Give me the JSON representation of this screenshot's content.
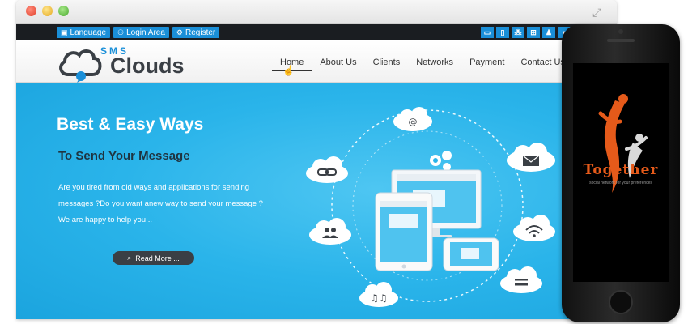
{
  "topbar": {
    "links": [
      {
        "label": "Language",
        "icon": "language-icon"
      },
      {
        "label": "Login Area",
        "icon": "user-icon"
      },
      {
        "label": "Register",
        "icon": "register-icon"
      }
    ],
    "social_icons": [
      "desktop-icon",
      "tablet-icon",
      "blackberry-icon",
      "windows-icon",
      "android-icon",
      "apple-icon",
      "rss-icon",
      "facebook-icon",
      "twitter-icon"
    ]
  },
  "logo": {
    "small": "SMS",
    "main": "Clouds"
  },
  "nav": {
    "items": [
      "Home",
      "About Us",
      "Clients",
      "Networks",
      "Payment",
      "Contact Us"
    ],
    "active": "Home"
  },
  "hero": {
    "title": "Best & Easy Ways",
    "subtitle": "To Send Your Message",
    "text_lines": [
      "Are you tired from old ways and applications for sending",
      "messages ?Do you want anew way to send your message ?",
      "We are happy to help you .."
    ],
    "button": "Read More ..."
  },
  "phone": {
    "app_name": "Together",
    "tagline": "social network for your preferences"
  },
  "colors": {
    "accent": "#1a8fd8",
    "hero_bg": "#2ab4ea",
    "dark": "#3a3f45",
    "brand_orange": "#e55a1a"
  }
}
